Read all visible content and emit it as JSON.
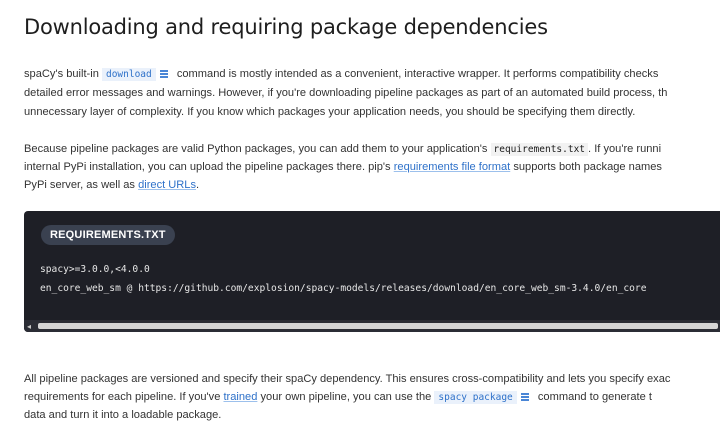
{
  "heading": "Downloading and requiring package dependencies",
  "para1": {
    "line1_pre": "spaCy's built-in",
    "code_download": "download",
    "line1_post": "command is mostly intended as a convenient, interactive wrapper. It performs compatibility checks",
    "line2": "detailed error messages and warnings. However, if you're downloading pipeline packages as part of an automated build process, th",
    "line3": "unnecessary layer of complexity. If you know which packages your application needs, you should be specifying them directly."
  },
  "para2": {
    "line1_pre": "Because pipeline packages are valid Python packages, you can add them to your application's",
    "code_requirements": "requirements.txt",
    "line1_post": ". If you're runni",
    "line2_pre": "internal PyPi installation, you can upload the pipeline packages there. pip's",
    "link_req_format": "requirements file format",
    "line2_post": "supports both package names",
    "line3_pre": "PyPi server, as well as",
    "link_direct_urls": "direct URLs",
    "line3_post": "."
  },
  "code_block": {
    "label": "REQUIREMENTS.TXT",
    "lines": [
      "spacy>=3.0.0,<4.0.0",
      "en_core_web_sm @ https://github.com/explosion/spacy-models/releases/download/en_core_web_sm-3.4.0/en_core"
    ],
    "scroll_left_arrow": "◂"
  },
  "para3": {
    "line1": "All pipeline packages are versioned and specify their spaCy dependency. This ensures cross-compatibility and lets you specify exac",
    "line2_pre": "requirements for each pipeline. If you've",
    "link_trained": "trained",
    "line2_mid": "your own pipeline, you can use the",
    "code_spacy_package": "spacy package",
    "line2_post": "command to generate t",
    "line3": "data and turn it into a loadable package."
  },
  "icons": {
    "command_doc": "docs-link-icon"
  },
  "colors": {
    "link": "#2e71c9",
    "code_bg": "#1e1f26",
    "label_bg": "#3a4150"
  }
}
